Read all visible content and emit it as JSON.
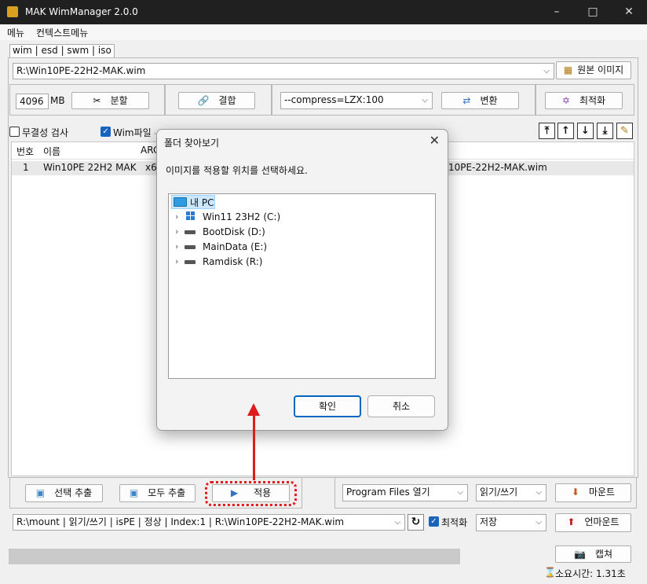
{
  "window": {
    "title": "MAK WimManager 2.0.0"
  },
  "menubar": {
    "items": [
      "메뉴",
      "컨텍스트메뉴"
    ]
  },
  "tabs": {
    "label": "wim | esd | swm | iso"
  },
  "source": {
    "path": "R:\\Win10PE-22H2-MAK.wim",
    "original_image_label": "원본 이미지"
  },
  "split": {
    "size": "4096",
    "unit": "MB",
    "split_label": "분할",
    "merge_label": "결합"
  },
  "convert": {
    "compress_option": "--compress=LZX:100",
    "convert_label": "변환",
    "optimize_label": "최적화"
  },
  "options": {
    "integrity_check": "무결성 검사",
    "wim_check_label": "Wim파일 추출시 경로 사용함"
  },
  "list": {
    "columns": [
      "번호",
      "이름",
      "ARC"
    ],
    "rows": [
      {
        "no": "1",
        "name": "Win10PE 22H2 MAK",
        "arch": "x6",
        "path": "10PE-22H2-MAK.wim"
      }
    ]
  },
  "dialog": {
    "title": "폴더 찾아보기",
    "prompt": "이미지를 적용할 위치를 선택하세요.",
    "tree": [
      {
        "label": "내 PC"
      },
      {
        "label": "Win11 23H2 (C:)"
      },
      {
        "label": "BootDisk (D:)"
      },
      {
        "label": "MainData (E:)"
      },
      {
        "label": "Ramdisk (R:)"
      }
    ],
    "ok_label": "확인",
    "cancel_label": "취소"
  },
  "bottom": {
    "extract_selected": "선택 추출",
    "extract_all": "모두 추출",
    "apply": "적용",
    "program_files": "Program Files 열기",
    "rw_mode": "읽기/쓰기",
    "mount": "마운트",
    "mount_status": "R:\\mount | 읽기/쓰기 | isPE | 정상 | Index:1 | R:\\Win10PE-22H2-MAK.wim",
    "optimize_check": "최적화",
    "save_option": "저장",
    "unmount": "언마운트",
    "capture": "캡쳐",
    "elapsed": "소요시간: 1.31초"
  },
  "colors": {
    "titlebar": "#202020",
    "accent": "#1565c0",
    "annotation": "#e01b1b"
  }
}
